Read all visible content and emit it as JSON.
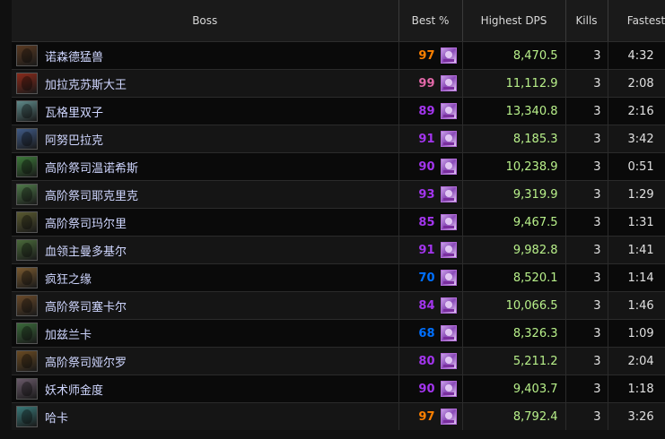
{
  "headers": {
    "boss": "Boss",
    "best": "Best %",
    "dps": "Highest DPS",
    "kills": "Kills",
    "fastest": "Fastest"
  },
  "colors": {
    "orange": "#ff8000",
    "pink": "#e268a8",
    "purple": "#a335ee",
    "blue": "#0070ff",
    "dps_green": "#b8f08a"
  },
  "rows": [
    {
      "boss": "诺森德猛兽",
      "best": "97",
      "best_color": "#ff8000",
      "dps": "8,470.5",
      "kills": "3",
      "fastest": "4:32",
      "portrait_color": "#5a3a22",
      "icon": "spec-icon"
    },
    {
      "boss": "加拉克苏斯大王",
      "best": "99",
      "best_color": "#e268a8",
      "dps": "11,112.9",
      "kills": "3",
      "fastest": "2:08",
      "portrait_color": "#8a2a1a",
      "icon": "spec-icon"
    },
    {
      "boss": "瓦格里双子",
      "best": "89",
      "best_color": "#a335ee",
      "dps": "13,340.8",
      "kills": "3",
      "fastest": "2:16",
      "portrait_color": "#5f8a8a",
      "icon": "spec-icon"
    },
    {
      "boss": "阿努巴拉克",
      "best": "91",
      "best_color": "#a335ee",
      "dps": "8,185.3",
      "kills": "3",
      "fastest": "3:42",
      "portrait_color": "#3f5a86",
      "icon": "spec-icon"
    },
    {
      "boss": "高阶祭司温诺希斯",
      "best": "90",
      "best_color": "#a335ee",
      "dps": "10,238.9",
      "kills": "3",
      "fastest": "0:51",
      "portrait_color": "#3d7a3a",
      "icon": "spec-icon"
    },
    {
      "boss": "高阶祭司耶克里克",
      "best": "93",
      "best_color": "#a335ee",
      "dps": "9,319.9",
      "kills": "3",
      "fastest": "1:29",
      "portrait_color": "#4f7a4a",
      "icon": "spec-icon"
    },
    {
      "boss": "高阶祭司玛尔里",
      "best": "85",
      "best_color": "#a335ee",
      "dps": "9,467.5",
      "kills": "3",
      "fastest": "1:31",
      "portrait_color": "#5a5a30",
      "icon": "spec-icon"
    },
    {
      "boss": "血领主曼多基尔",
      "best": "91",
      "best_color": "#a335ee",
      "dps": "9,982.8",
      "kills": "3",
      "fastest": "1:41",
      "portrait_color": "#4a6a3a",
      "icon": "spec-icon"
    },
    {
      "boss": "疯狂之缘",
      "best": "70",
      "best_color": "#0070ff",
      "dps": "8,520.1",
      "kills": "3",
      "fastest": "1:14",
      "portrait_color": "#7a5a30",
      "icon": "spec-icon"
    },
    {
      "boss": "高阶祭司塞卡尔",
      "best": "84",
      "best_color": "#a335ee",
      "dps": "10,066.5",
      "kills": "3",
      "fastest": "1:46",
      "portrait_color": "#6a4a2a",
      "icon": "spec-icon"
    },
    {
      "boss": "加兹兰卡",
      "best": "68",
      "best_color": "#0070ff",
      "dps": "8,326.3",
      "kills": "3",
      "fastest": "1:09",
      "portrait_color": "#3a6a3a",
      "icon": "spec-icon"
    },
    {
      "boss": "高阶祭司娅尔罗",
      "best": "80",
      "best_color": "#a335ee",
      "dps": "5,211.2",
      "kills": "3",
      "fastest": "2:04",
      "portrait_color": "#6a4a22",
      "icon": "spec-icon"
    },
    {
      "boss": "妖术师金度",
      "best": "90",
      "best_color": "#a335ee",
      "dps": "9,403.7",
      "kills": "3",
      "fastest": "1:18",
      "portrait_color": "#6a5a6a",
      "icon": "spec-icon"
    },
    {
      "boss": "哈卡",
      "best": "97",
      "best_color": "#ff8000",
      "dps": "8,792.4",
      "kills": "3",
      "fastest": "3:26",
      "portrait_color": "#3a7a7a",
      "icon": "spec-icon"
    }
  ]
}
